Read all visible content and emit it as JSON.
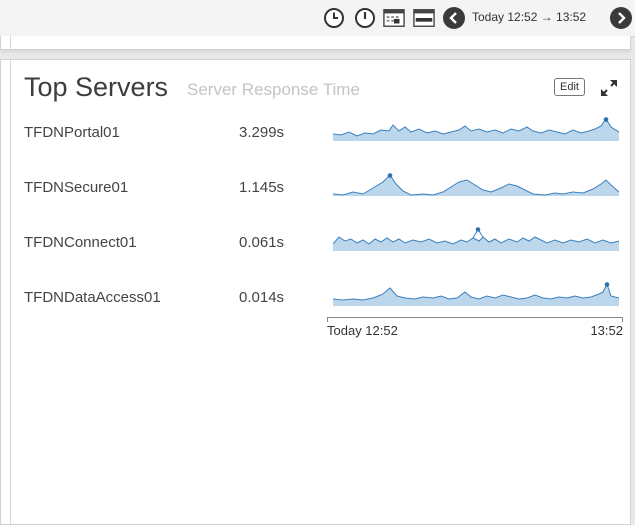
{
  "toolbar": {
    "range_text": "Today 12:52 → 13:52"
  },
  "panel": {
    "title": "Top Servers",
    "subtitle": "Server Response Time",
    "edit_label": "Edit"
  },
  "servers": [
    {
      "name": "TFDNPortal01",
      "value": "3.299s"
    },
    {
      "name": "TFDNSecure01",
      "value": "1.145s"
    },
    {
      "name": "TFDNConnect01",
      "value": "0.061s"
    },
    {
      "name": "TFDNDataAccess01",
      "value": "0.014s"
    }
  ],
  "time_axis": {
    "start": "Today 12:52",
    "end": "13:52"
  },
  "colors": {
    "spark_fill": "#bcd7ec",
    "spark_line": "#3b7fbf",
    "spark_peak": "#2f6ea8",
    "nav_button": "#3a3a3a"
  }
}
